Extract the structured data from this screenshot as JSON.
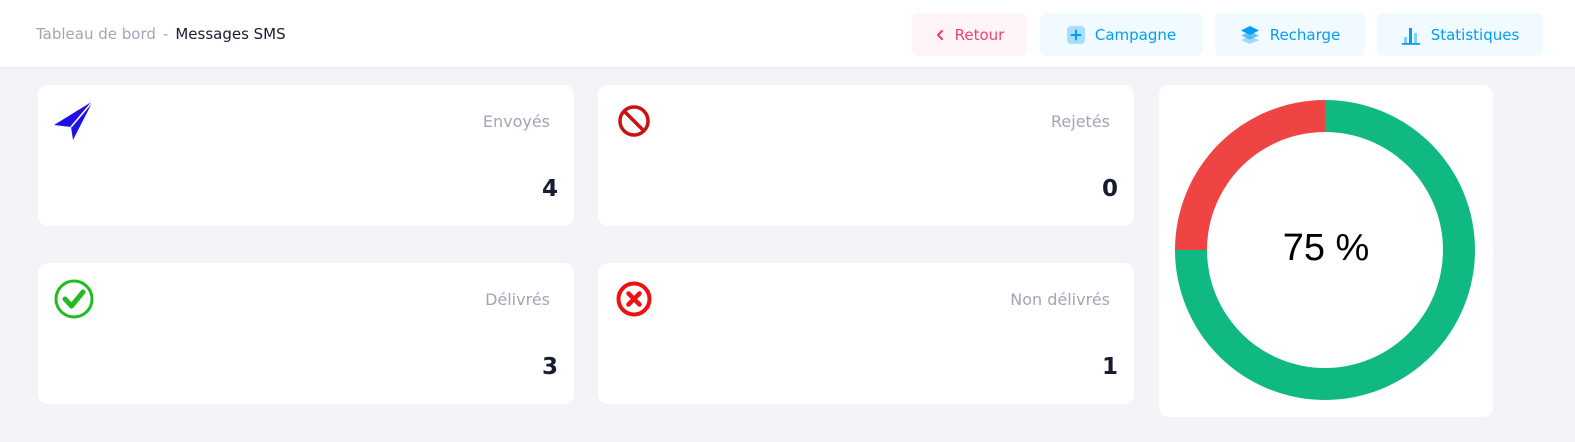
{
  "breadcrumb": {
    "parent": "Tableau de bord",
    "separator": "-",
    "current": "Messages SMS"
  },
  "toolbar": {
    "back_label": "Retour",
    "campaign_label": "Campagne",
    "recharge_label": "Recharge",
    "stats_label": "Statistiques"
  },
  "stats": {
    "sent": {
      "label": "Envoyés",
      "value": "4",
      "icon": "paper-plane-icon",
      "color": "#1e10e8"
    },
    "rejected": {
      "label": "Rejetés",
      "value": "0",
      "icon": "ban-icon",
      "color": "#cc1111"
    },
    "delivered": {
      "label": "Délivrés",
      "value": "3",
      "icon": "check-circle-icon",
      "color": "#22bb22"
    },
    "undelivered": {
      "label": "Non délivrés",
      "value": "1",
      "icon": "x-circle-icon",
      "color": "#ee1111"
    }
  },
  "chart_data": {
    "type": "pie",
    "variant": "doughnut",
    "center_label": "75 %",
    "slices": [
      {
        "value": 75,
        "color": "#10b981"
      },
      {
        "value": 25,
        "color": "#ef4444"
      }
    ]
  },
  "colors": {
    "back_text": "#f1416c",
    "back_bg": "#fff5f8",
    "primary_text": "#009ef7",
    "primary_bg": "#f1faff",
    "page_bg": "#f2f4f8"
  }
}
